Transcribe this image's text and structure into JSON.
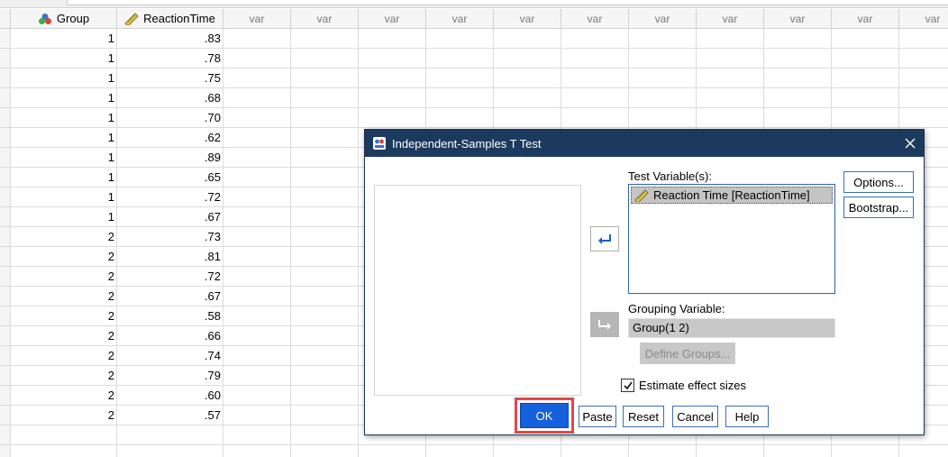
{
  "spreadsheet": {
    "columns": [
      {
        "name": "Group",
        "type": "nominal"
      },
      {
        "name": "ReactionTime",
        "type": "scale"
      },
      {
        "name": "var"
      },
      {
        "name": "var"
      },
      {
        "name": "var"
      },
      {
        "name": "var"
      },
      {
        "name": "var"
      },
      {
        "name": "var"
      },
      {
        "name": "var"
      },
      {
        "name": "var"
      },
      {
        "name": "var"
      },
      {
        "name": "var"
      },
      {
        "name": "var"
      }
    ],
    "rows": [
      [
        "1",
        ".83"
      ],
      [
        "1",
        ".78"
      ],
      [
        "1",
        ".75"
      ],
      [
        "1",
        ".68"
      ],
      [
        "1",
        ".70"
      ],
      [
        "1",
        ".62"
      ],
      [
        "1",
        ".89"
      ],
      [
        "1",
        ".65"
      ],
      [
        "1",
        ".72"
      ],
      [
        "1",
        ".67"
      ],
      [
        "2",
        ".73"
      ],
      [
        "2",
        ".81"
      ],
      [
        "2",
        ".72"
      ],
      [
        "2",
        ".67"
      ],
      [
        "2",
        ".58"
      ],
      [
        "2",
        ".66"
      ],
      [
        "2",
        ".74"
      ],
      [
        "2",
        ".79"
      ],
      [
        "2",
        ".60"
      ],
      [
        "2",
        ".57"
      ],
      [
        "",
        ""
      ],
      [
        "",
        ""
      ]
    ]
  },
  "dialog": {
    "title": "Independent-Samples T Test",
    "test_variables_label": "Test Variable(s):",
    "test_variables": [
      "Reaction Time [ReactionTime]"
    ],
    "grouping_variable_label": "Grouping Variable:",
    "grouping_variable_value": "Group(1 2)",
    "define_groups_label": "Define Groups...",
    "estimate_effect_sizes_label": "Estimate effect sizes",
    "estimate_effect_sizes_checked": true,
    "options_label": "Options...",
    "bootstrap_label": "Bootstrap...",
    "buttons": {
      "ok": "OK",
      "paste": "Paste",
      "reset": "Reset",
      "cancel": "Cancel",
      "help": "Help"
    },
    "highlight_color": "#e14848",
    "title_bar_color": "#1c3a5e"
  }
}
